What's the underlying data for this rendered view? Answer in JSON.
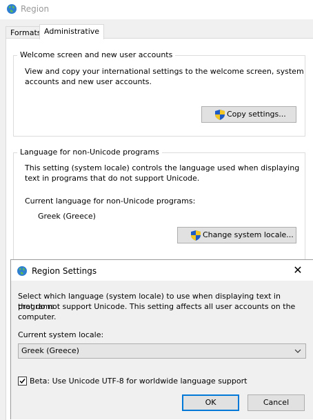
{
  "window": {
    "title": "Region"
  },
  "tabs": [
    {
      "label": "Formats"
    },
    {
      "label": "Administrative"
    }
  ],
  "welcome": {
    "title": "Welcome screen and new user accounts",
    "description_line1": "View and copy your international settings to the welcome screen, system",
    "description_line2": "accounts and new user accounts.",
    "copy_button": "Copy settings..."
  },
  "nonunicode": {
    "title": "Language for non-Unicode programs",
    "description_line1": "This setting (system locale) controls the language used when displaying",
    "description_line2": "text in programs that do not support Unicode.",
    "current_label": "Current language for non-Unicode programs:",
    "current_value": "Greek (Greece)",
    "change_button": "Change system locale..."
  },
  "dialog": {
    "title": "Region Settings",
    "close_glyph": "✕",
    "description_line1": "Select which language (system locale) to use when displaying text in programs",
    "description_line2": "that do not support Unicode. This setting affects all user accounts on the",
    "description_line3": "computer.",
    "locale_label": "Current system locale:",
    "locale_value": "Greek (Greece)",
    "beta_checked": true,
    "beta_label": "Beta: Use Unicode UTF-8 for worldwide language support",
    "ok_button": "OK",
    "cancel_button": "Cancel"
  },
  "icons": {
    "window": "globe-icon",
    "shield": "uac-shield-icon",
    "close": "close-icon",
    "dropdown": "chevron-down-icon",
    "check": "checkmark-icon"
  },
  "colors": {
    "accent": "#0078d7",
    "button_face": "#e1e1e1"
  }
}
